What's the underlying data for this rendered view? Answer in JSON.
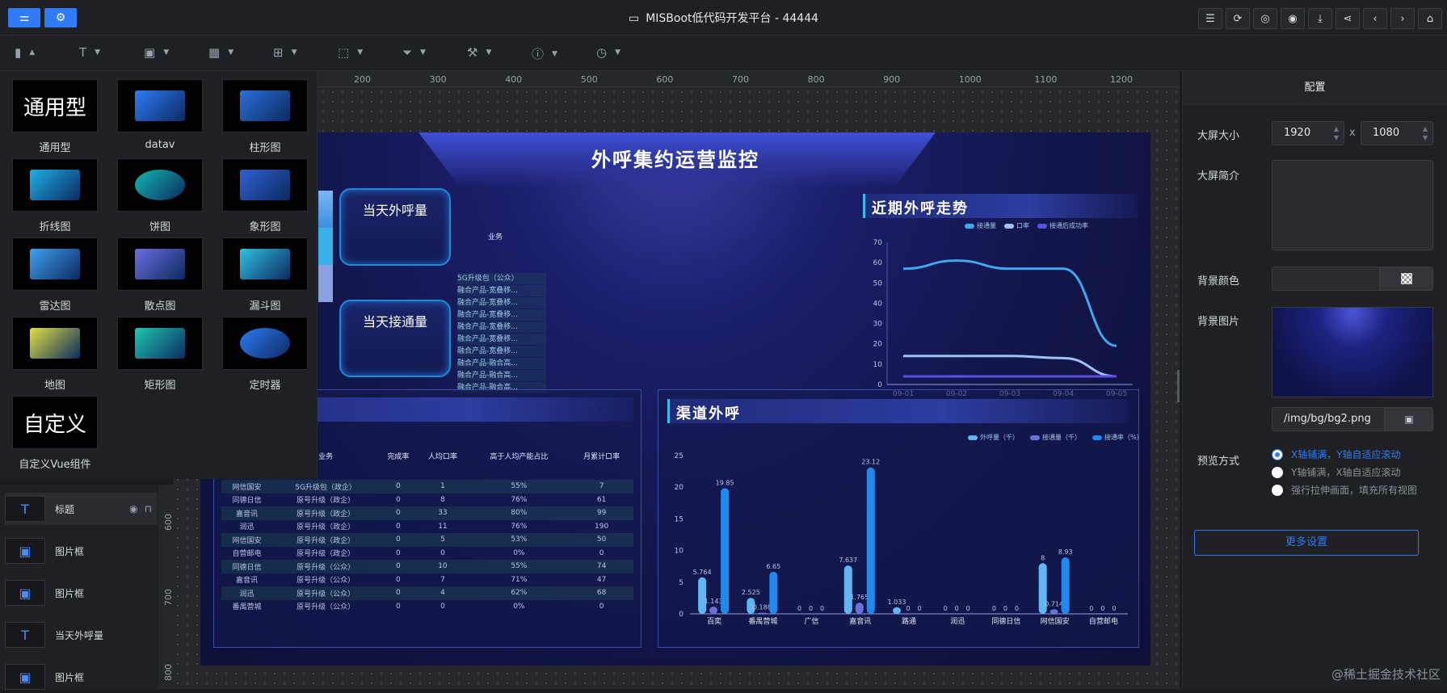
{
  "app": {
    "title": "MISBoot低代码开发平台 - 44444",
    "icons": {
      "left1": "sliders-icon",
      "left2": "gear-icon",
      "title": "presentation-icon"
    }
  },
  "top_right_tools": [
    {
      "name": "notes-icon",
      "glyph": "☰"
    },
    {
      "name": "refresh-icon",
      "glyph": "⟳"
    },
    {
      "name": "camera-icon",
      "glyph": "◎"
    },
    {
      "name": "eye-icon",
      "glyph": "◉"
    },
    {
      "name": "download-icon",
      "glyph": "⤓"
    },
    {
      "name": "share-icon",
      "glyph": "⋖"
    },
    {
      "name": "prev-icon",
      "glyph": "‹"
    },
    {
      "name": "next-icon",
      "glyph": "›"
    },
    {
      "name": "home-icon",
      "glyph": "⌂"
    }
  ],
  "toolbar": [
    {
      "name": "chart-tool",
      "glyph": "▮"
    },
    {
      "name": "text-tool",
      "glyph": "T"
    },
    {
      "name": "image-tool",
      "glyph": "▣"
    },
    {
      "name": "grid-tool",
      "glyph": "▦"
    },
    {
      "name": "table-tool",
      "glyph": "⊞"
    },
    {
      "name": "border-tool",
      "glyph": "⬚"
    },
    {
      "name": "filter-tool",
      "glyph": "⏷"
    },
    {
      "name": "brush-tool",
      "glyph": "⚒"
    },
    {
      "name": "info-tool",
      "glyph": "ⓘ"
    },
    {
      "name": "clock-tool",
      "glyph": "◷"
    }
  ],
  "ruler": {
    "h_labels": [
      "200",
      "300",
      "400",
      "500",
      "600",
      "700",
      "800",
      "900",
      "1000",
      "1100",
      "1200"
    ],
    "v_labels": [
      "600",
      "700",
      "800"
    ]
  },
  "palette": [
    {
      "label": "通用型",
      "thumb": "通用型"
    },
    {
      "label": "datav",
      "thumb": ""
    },
    {
      "label": "柱形图",
      "thumb": ""
    },
    {
      "label": "折线图",
      "thumb": ""
    },
    {
      "label": "饼图",
      "thumb": ""
    },
    {
      "label": "象形图",
      "thumb": ""
    },
    {
      "label": "雷达图",
      "thumb": ""
    },
    {
      "label": "散点图",
      "thumb": ""
    },
    {
      "label": "漏斗图",
      "thumb": ""
    },
    {
      "label": "地图",
      "thumb": ""
    },
    {
      "label": "矩形图",
      "thumb": ""
    },
    {
      "label": "定时器",
      "thumb": ""
    },
    {
      "label": "自定义Vue组件",
      "thumb": "自定义"
    }
  ],
  "layers": [
    {
      "label": "标题",
      "icon": "T",
      "selected": true
    },
    {
      "label": "图片框",
      "icon": "▣",
      "selected": false
    },
    {
      "label": "图片框",
      "icon": "▣",
      "selected": false
    },
    {
      "label": "当天外呼量",
      "icon": "T",
      "selected": false
    },
    {
      "label": "图片框",
      "icon": "▣",
      "selected": false
    }
  ],
  "screen": {
    "title": "外呼集约运营监控",
    "card1": "当天外呼量",
    "card2": "当天接通量",
    "biz_header": "业务",
    "mini_list": [
      "5G升级包（公众）",
      "融合产品-宽叠移...",
      "融合产品-宽叠移...",
      "融合产品-宽叠移...",
      "融合产品-宽叠移...",
      "融合产品-宽叠移...",
      "融合产品-宽叠移...",
      "融合产品-融合高...",
      "融合产品-融合高...",
      "融合产品-融合高..."
    ],
    "trend_title": "近期外呼走势",
    "trend_legend": [
      "接通量",
      "口率",
      "接通后成功率"
    ],
    "channel_title": "渠道外呼",
    "channel_legend": [
      "外呼量（千）",
      "接通量（千）",
      "接通率（%）"
    ],
    "table": {
      "headers": [
        "",
        "业务",
        "完成率",
        "人均口率",
        "高于人均产能占比",
        "月累计口率"
      ],
      "rows": [
        [
          "网信国安",
          "5G升级包（政企）",
          "0",
          "1",
          "55%",
          "7"
        ],
        [
          "同德日信",
          "原号升级（政企）",
          "0",
          "8",
          "76%",
          "61"
        ],
        [
          "嘉音讯",
          "原号升级（政企）",
          "0",
          "33",
          "80%",
          "99"
        ],
        [
          "润迅",
          "原号升级（政企）",
          "0",
          "11",
          "76%",
          "190"
        ],
        [
          "网信国安",
          "原号升级（政企）",
          "0",
          "5",
          "53%",
          "50"
        ],
        [
          "自营邮电",
          "原号升级（政企）",
          "0",
          "0",
          "0%",
          "0"
        ],
        [
          "同德日信",
          "原号升级（公众）",
          "0",
          "10",
          "55%",
          "74"
        ],
        [
          "嘉音讯",
          "原号升级（公众）",
          "0",
          "7",
          "71%",
          "47"
        ],
        [
          "润迅",
          "原号升级（公众）",
          "0",
          "4",
          "62%",
          "68"
        ],
        [
          "番禺营城",
          "原号升级（公众）",
          "0",
          "0",
          "0%",
          "0"
        ]
      ]
    }
  },
  "right_panel": {
    "tab": "配置",
    "size_label": "大屏大小",
    "width": "1920",
    "x_sep": "x",
    "height": "1080",
    "intro_label": "大屏简介",
    "bgcolor_label": "背景颜色",
    "bgimg_label": "背景图片",
    "bgimg_path": "/img/bg/bg2.png",
    "preview_label": "预览方式",
    "preview_options": [
      {
        "label": "X轴铺满，Y轴自适应滚动",
        "selected": true
      },
      {
        "label": "Y轴铺满，X轴自适应滚动",
        "selected": false
      },
      {
        "label": "强行拉伸画面，填充所有视图",
        "selected": false
      }
    ],
    "more_button": "更多设置"
  },
  "watermark": "@稀土掘金技术社区",
  "colors": {
    "accent": "#2f7bf5",
    "bg": "#1a1b1e",
    "panel": "#1f2024"
  },
  "chart_data": [
    {
      "type": "line",
      "title": "近期外呼走势",
      "x": [
        "09-01",
        "09-02",
        "09-03",
        "09-04",
        "09-05"
      ],
      "ylim": [
        0,
        70
      ],
      "yticks": [
        "0",
        "10",
        "20",
        "30",
        "40",
        "50",
        "60",
        "70"
      ],
      "series": [
        {
          "name": "接通量",
          "values": [
            57,
            61,
            57,
            57,
            19
          ],
          "color": "#3fa6f0"
        },
        {
          "name": "口率",
          "values": [
            14,
            14,
            14,
            13,
            4
          ],
          "color": "#9fc2f5"
        },
        {
          "name": "接通后成功率",
          "values": [
            4,
            4,
            4,
            4,
            4
          ],
          "color": "#5a4fe0"
        }
      ]
    },
    {
      "type": "bar",
      "title": "渠道外呼",
      "categories": [
        "百奕",
        "番禺营城",
        "广信",
        "嘉音讯",
        "路通",
        "润迅",
        "同德日信",
        "网信国安",
        "自营邮电"
      ],
      "ylim": [
        0,
        25
      ],
      "yticks": [
        "0",
        "5",
        "10",
        "15",
        "20",
        "25"
      ],
      "series": [
        {
          "name": "外呼量（千）",
          "values": [
            5.764,
            2.525,
            0,
            7.637,
            1.033,
            0,
            0,
            8,
            0
          ],
          "color": "#5fb6f5"
        },
        {
          "name": "接通量（千）",
          "values": [
            1.143,
            0.188,
            0,
            1.765,
            0,
            0,
            0,
            0.714,
            0
          ],
          "color": "#6b6fd8"
        },
        {
          "name": "接通率（%）",
          "values": [
            19.85,
            6.65,
            0,
            23.12,
            0,
            0,
            0,
            8.93,
            0
          ],
          "color": "#1e8af0"
        }
      ]
    }
  ]
}
